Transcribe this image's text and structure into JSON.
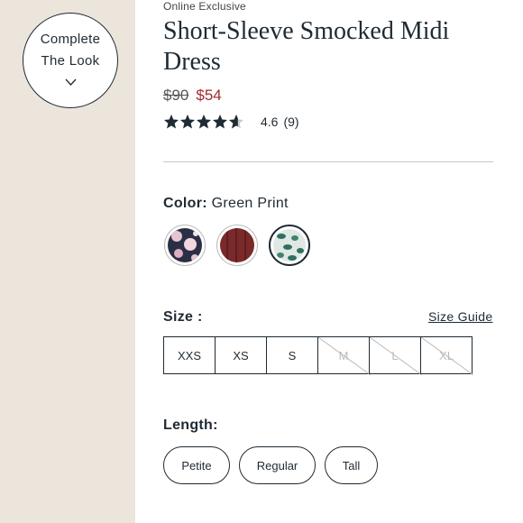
{
  "left_panel": {
    "complete_look": {
      "line1": "Complete",
      "line2": "The Look",
      "icon": "chevron-down-icon"
    }
  },
  "product": {
    "eyebrow": "Online Exclusive",
    "title": "Short-Sleeve Smocked Midi Dress",
    "price": {
      "original": "$90",
      "sale": "$54"
    },
    "rating": {
      "stars": 4.6,
      "value": "4.6",
      "count": "(9)"
    },
    "colors": {
      "label": "Color:",
      "selected": "Green Print",
      "swatches": [
        {
          "name": "navy floral",
          "base": "#2b2f45",
          "accent": "#e7c4d2"
        },
        {
          "name": "burgundy",
          "base": "#7a2a2a",
          "accent": "#5e1e1e"
        },
        {
          "name": "green print",
          "base": "#dfe8e2",
          "accent": "#2f6e63"
        }
      ]
    },
    "size": {
      "label": "Size :",
      "guide": "Size Guide",
      "options": [
        {
          "label": "XXS",
          "available": true
        },
        {
          "label": "XS",
          "available": true
        },
        {
          "label": "S",
          "available": true
        },
        {
          "label": "M",
          "available": false
        },
        {
          "label": "L",
          "available": false
        },
        {
          "label": "XL",
          "available": false
        }
      ]
    },
    "length": {
      "label": "Length:",
      "options": [
        "Petite",
        "Regular",
        "Tall"
      ]
    }
  },
  "colors": {
    "text": "#1f2a33",
    "sale": "#9e2a2f",
    "panel_bg": "#ece5dc",
    "star": "#1f2a33"
  }
}
